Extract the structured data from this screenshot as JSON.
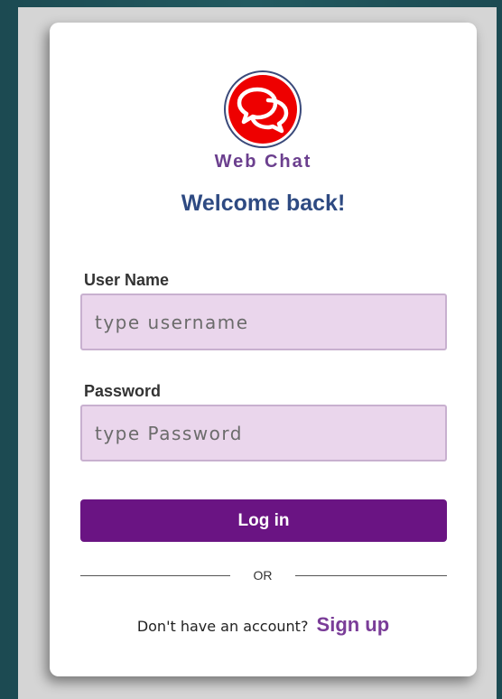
{
  "app": {
    "name": "Web Chat",
    "logo_icon": "chat-bubbles-icon"
  },
  "heading": "Welcome back!",
  "username": {
    "label": "User Name",
    "value": "",
    "placeholder": "type username"
  },
  "password": {
    "label": "Password",
    "value": "",
    "placeholder": "type Password"
  },
  "login_button": "Log in",
  "divider_text": "OR",
  "signup": {
    "prompt": "Don't have an account?",
    "link_label": "Sign up"
  },
  "colors": {
    "background": "#1f4f55",
    "card": "#ffffff",
    "brand_purple": "#6a1483",
    "heading_blue": "#2e4a82",
    "input_fill": "#ead6ec",
    "logo_red": "#ee0000"
  }
}
